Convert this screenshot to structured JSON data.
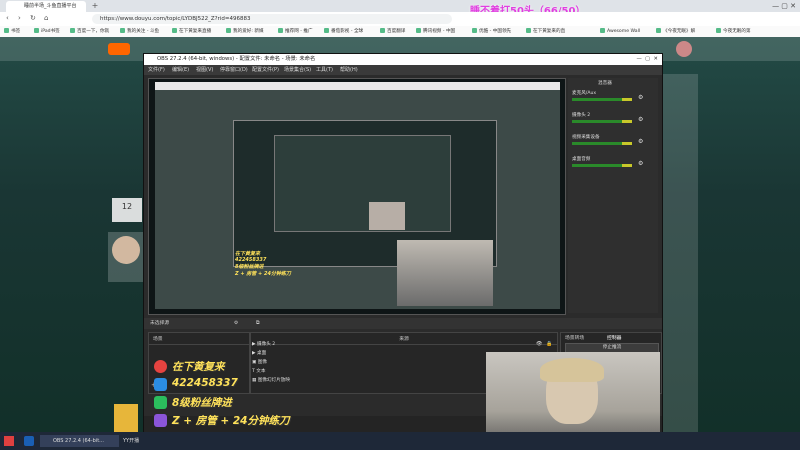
{
  "browser": {
    "tabs": [
      "睡前半场_斗鱼直播平台"
    ],
    "url": "https://www.douyu.com/topic/LYDBJ522_Z?rid=496883",
    "bookmarks": [
      "书签",
      "iPad书签",
      "百度一下，你就",
      "我的关注 - 斗鱼",
      "在下黄复来直播",
      "我的爱好: 新媒",
      "推荐网 - 推广",
      "番茄影视 - 全球",
      "百度翻译",
      "腾讯视频 - 中国",
      "优酷 - 中国领先",
      "在下黄复来的直",
      "Awesome Wall",
      "《今夜无眠》解",
      "今夜无眠的第"
    ]
  },
  "overlay_title": "睡不着打50头（66/50）",
  "obs": {
    "title": "OBS 27.2.4 (64-bit, windows) - 配置文件: 未命名 - 场景: 未命名",
    "menus": [
      "文件(F)",
      "编辑(E)",
      "视图(V)",
      "停靠窗口(D)",
      "配置文件(P)",
      "场景集合(S)",
      "工具(T)",
      "帮助(H)"
    ],
    "mixer_title": "混音器",
    "mixer_channels": [
      "麦克风/Aux",
      "摄像头 2",
      "视频采集设备",
      "桌面音频"
    ],
    "scenes_bar": "未选择源",
    "scenes_label": "场景",
    "sources_label": "来源",
    "sources": [
      "摄像头 2",
      "桌面",
      "图像",
      "文本",
      "图像幻灯片放映"
    ],
    "tabs": [
      "场景转场",
      "控制器"
    ],
    "controls": [
      "停止推流"
    ]
  },
  "streamer_overlay": {
    "lines": [
      "在下黄复来",
      "422458337",
      "8级粉丝牌进",
      "Z + 房管 + 24分钟练刀"
    ]
  },
  "side": {
    "level": "12"
  },
  "taskbar": {
    "items": [
      "OBS 27.2.4 (64-bit...",
      "YY开播"
    ]
  }
}
